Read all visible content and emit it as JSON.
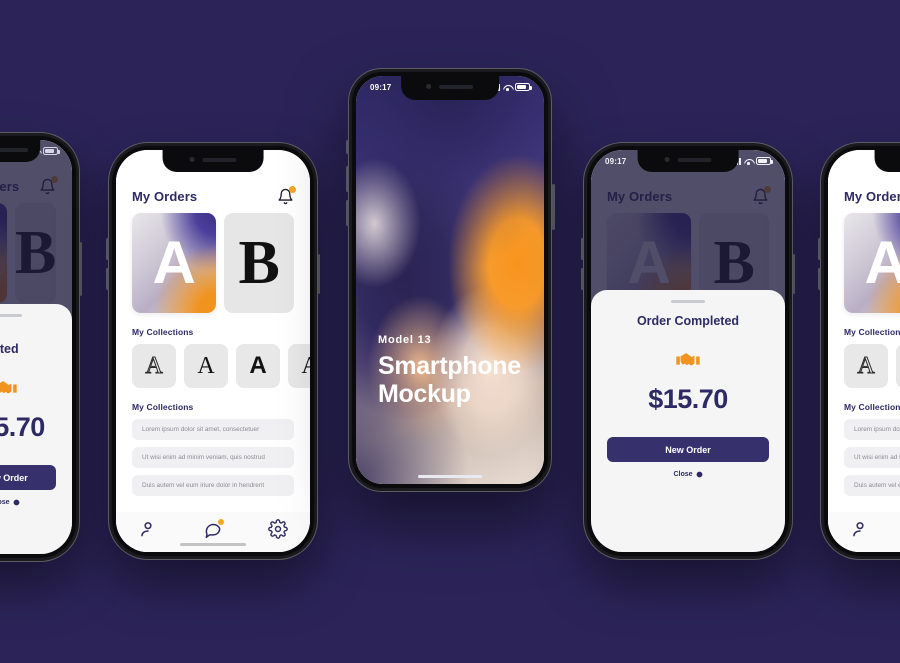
{
  "background_color": "#2c2459",
  "accent_color": "#f0931f",
  "brand_color": "#2e2a63",
  "status_bar": {
    "time": "09:17",
    "signal_icon": "signal-icon",
    "wifi_icon": "wifi-icon",
    "battery_icon": "battery-icon"
  },
  "orders_app": {
    "title": "My Orders",
    "bell_icon": "bell-icon",
    "featured_cards": [
      {
        "letter": "A",
        "style": "gradient"
      },
      {
        "letter": "B",
        "style": "grey"
      }
    ],
    "collections_title": "My Collections",
    "collection_tiles": [
      {
        "letter": "A"
      },
      {
        "letter": "A"
      },
      {
        "letter": "A"
      },
      {
        "letter": "A"
      }
    ],
    "list_title": "My Collections",
    "list_items": [
      "Lorem ipsum dolor sit amet, consectetuer",
      "Ut wisi enim ad minim veniam, quis nostrud",
      "Duis autem vel eum iriure dolor in hendrerit"
    ],
    "tabs": [
      {
        "name": "profile-tab",
        "icon": "person-icon",
        "badge": false
      },
      {
        "name": "messages-tab",
        "icon": "chat-icon",
        "badge": true
      },
      {
        "name": "settings-tab",
        "icon": "gear-icon",
        "badge": false
      }
    ]
  },
  "order_sheet": {
    "title": "Order Completed",
    "icon": "handshake-icon",
    "amount": "$15.70",
    "primary_button": "New Order",
    "close_label": "Close",
    "close_icon": "close-circle-icon"
  },
  "hero_phone": {
    "model_label": "Model 13",
    "product_name_line1": "Smartphone",
    "product_name_line2": "Mockup",
    "wallpaper": "orange-indigo-swirl-gradient"
  }
}
